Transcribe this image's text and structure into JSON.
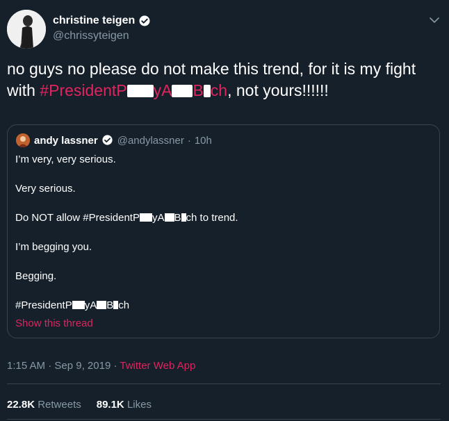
{
  "author": {
    "name": "christine teigen",
    "handle": "@chrissyteigen"
  },
  "tweet": {
    "text_before": "no guys no please do not make this trend, for it is my fight with ",
    "hashtag_a": "#PresidentP",
    "hashtag_b": "yA",
    "hashtag_c": "B",
    "hashtag_d": "ch",
    "text_after": ", not yours!!!!!!"
  },
  "quote": {
    "name": "andy lassner",
    "handle": "@andylassner",
    "time": "10h",
    "lines": [
      "I’m very, very serious.",
      "Very serious.",
      "Do NOT allow ",
      "I’m begging you.",
      "Begging."
    ],
    "line3_hashtag_a": "#PresidentP",
    "line3_hashtag_b": "yA",
    "line3_hashtag_c": "B",
    "line3_hashtag_d": "ch",
    "line3_suffix": " to trend.",
    "last_a": "#PresidentP",
    "last_b": "yA",
    "last_c": "B",
    "last_d": "ch",
    "show_thread": "Show this thread"
  },
  "footer": {
    "time": "1:15 AM",
    "date": "Sep 9, 2019",
    "app": "Twitter Web App",
    "retweets_count": "22.8K",
    "retweets_label": "Retweets",
    "likes_count": "89.1K",
    "likes_label": "Likes"
  },
  "colors": {
    "background": "#15202b",
    "accent": "#e0245e",
    "muted": "#8899a6",
    "border": "#38444d"
  }
}
